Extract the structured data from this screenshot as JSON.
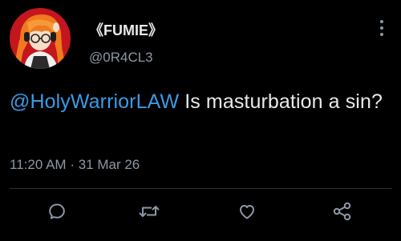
{
  "author": {
    "display_name": "《FUMIE》",
    "handle": "@0R4CL3",
    "avatar_icon": "avatar-image"
  },
  "tweet": {
    "mention": "@HolyWarriorLAW",
    "text": " Is masturbation a sin?",
    "time": "11:20 AM",
    "separator": "·",
    "date": "31 Mar 26"
  },
  "actions": [
    {
      "name": "reply",
      "icon": "reply-icon"
    },
    {
      "name": "retweet",
      "icon": "retweet-icon"
    },
    {
      "name": "like",
      "icon": "like-icon"
    },
    {
      "name": "share",
      "icon": "share-icon"
    }
  ],
  "colors": {
    "background": "#000000",
    "text": "#e7e9ea",
    "secondary": "#8b98a5",
    "link": "#3b9ae6",
    "divider": "#2f3336"
  }
}
